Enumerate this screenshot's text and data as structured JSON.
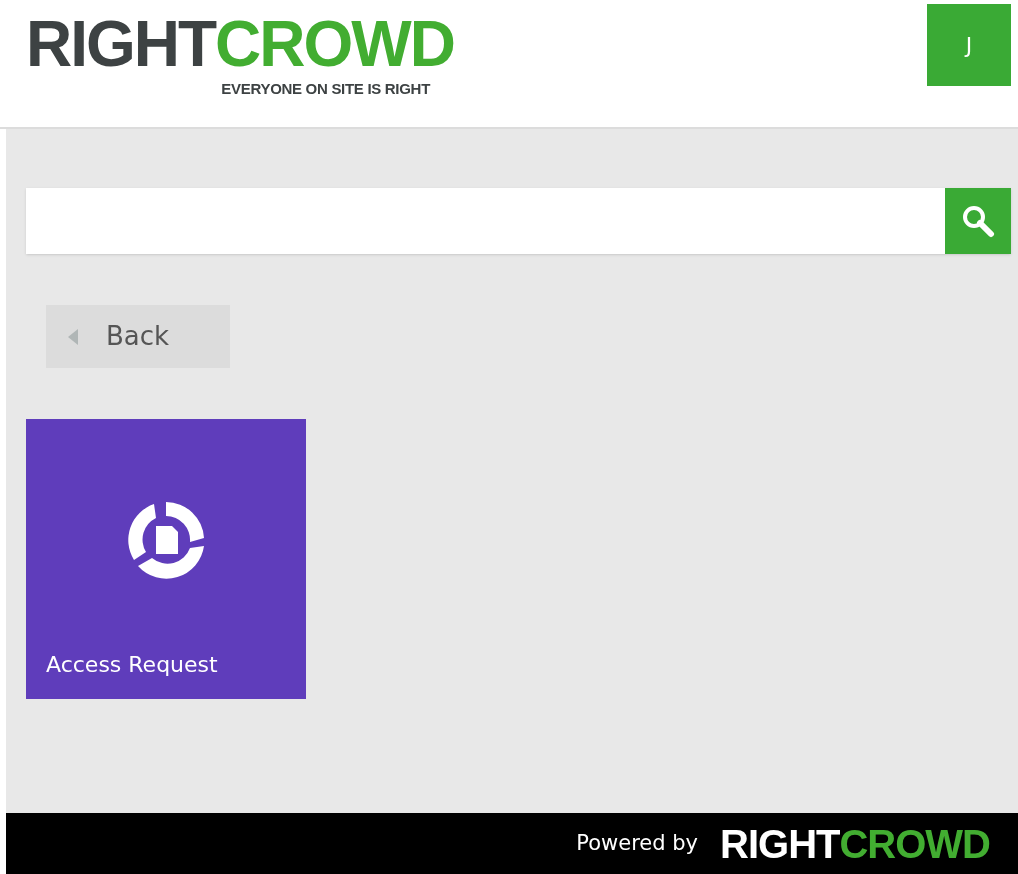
{
  "header": {
    "logo": {
      "word_1": "RIGHT",
      "word_2": "CROWD",
      "tagline": "EVERYONE ON SITE IS RIGHT"
    },
    "user_initial": "J"
  },
  "back_button": {
    "label": "Back"
  },
  "tiles": [
    {
      "label": "Access Request"
    }
  ],
  "footer": {
    "powered_by": "Powered by",
    "logo": {
      "word_1": "RIGHT",
      "word_2": "CROWD"
    }
  }
}
